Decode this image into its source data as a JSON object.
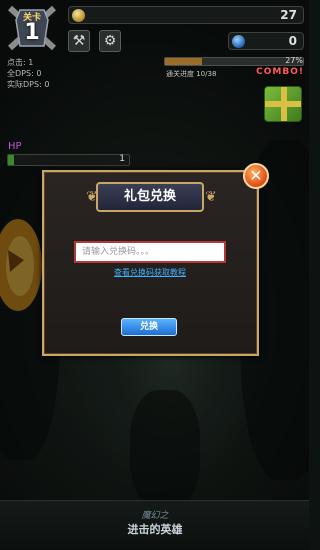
{
  "hud": {
    "level_label": "关卡",
    "level_number": "1",
    "gold": "27",
    "gems": "0",
    "stats": {
      "clicks_label": "点击",
      "clicks_value": "1",
      "total_dps_label": "全DPS",
      "total_dps_value": "0",
      "real_dps_label": "实际DPS",
      "real_dps_value": "0"
    },
    "progress_percent": "27%",
    "progress_fraction": 0.27,
    "boss_label": "通关进度 10/38",
    "combo_text": "COMBO!",
    "hp_label": "HP",
    "hp_value": "1"
  },
  "dialog": {
    "title": "礼包兑换",
    "input_placeholder": "请输入兑换码。。。",
    "tutorial_link": "查看兑换码获取教程",
    "redeem_button": "兑换",
    "close_icon": "close-icon"
  },
  "logo": {
    "line1": "魔幻之",
    "line2": "进击的英雄"
  },
  "colors": {
    "accent_gold": "#c9a766",
    "button_blue": "#1c6fd1",
    "link_blue": "#3db1ff",
    "close_orange": "#e04a12"
  }
}
